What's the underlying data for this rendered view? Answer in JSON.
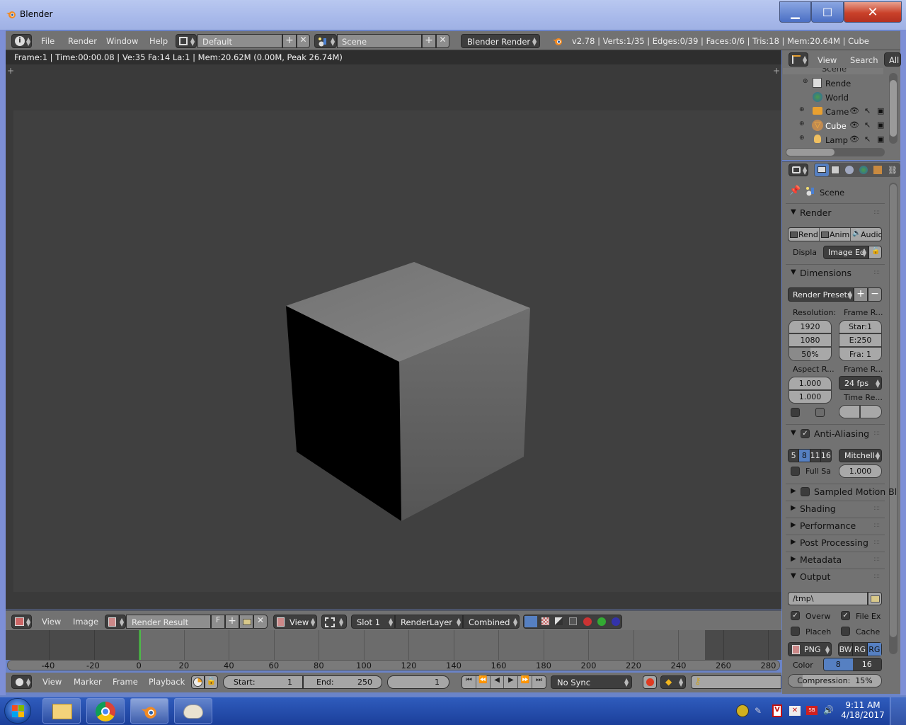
{
  "window": {
    "title": "Blender",
    "controls": {
      "minimize": "▁",
      "maximize": "☐",
      "close": "✕"
    }
  },
  "top_header": {
    "menus": [
      "File",
      "Render",
      "Window",
      "Help"
    ],
    "screen_layout": "Default",
    "scene": "Scene",
    "engine": "Blender Render",
    "stats": "v2.78 | Verts:1/35 | Edges:0/39 | Faces:0/6 | Tris:18 | Mem:20.64M | Cube"
  },
  "render_info": "Frame:1 | Time:00:00.08 | Ve:35 Fa:14 La:1 | Mem:20.62M (0.00M, Peak 26.74M)",
  "image_editor_header": {
    "menus": [
      "View",
      "Image"
    ],
    "image_name": "Render Result",
    "fake_user": "F",
    "view_mode": "View",
    "slot": "Slot 1",
    "render_layer": "RenderLayer",
    "pass": "Combined"
  },
  "timeline": {
    "ticks": [
      "-40",
      "-20",
      "0",
      "20",
      "40",
      "60",
      "80",
      "100",
      "120",
      "140",
      "160",
      "180",
      "200",
      "220",
      "240",
      "260",
      "280"
    ],
    "current_frame_marker": 1,
    "menus": [
      "View",
      "Marker",
      "Frame",
      "Playback"
    ],
    "start_label": "Start:",
    "start_value": "1",
    "end_label": "End:",
    "end_value": "250",
    "current_frame": "1",
    "sync": "No Sync",
    "controls": [
      "⏮",
      "⏪",
      "◀",
      "▶",
      "⏩",
      "⏭"
    ]
  },
  "outliner": {
    "header": {
      "view": "View",
      "search": "Search",
      "filter": "All"
    },
    "items": [
      {
        "label": "Scene",
        "icon": "scene-icon",
        "selected": false
      },
      {
        "label": "Rende",
        "icon": "render-layers-icon",
        "selected": false
      },
      {
        "label": "World",
        "icon": "world-icon",
        "selected": false
      },
      {
        "label": "Came",
        "icon": "camera-icon",
        "selected": false
      },
      {
        "label": "Cube",
        "icon": "mesh-icon",
        "selected": true
      },
      {
        "label": "Lamp",
        "icon": "lamp-icon",
        "selected": false
      }
    ]
  },
  "properties": {
    "context": "Scene",
    "render": {
      "title": "Render",
      "buttons": [
        "Rend",
        "Anim",
        "Audio"
      ],
      "display_label": "Displa",
      "display_value": "Image Ed"
    },
    "dimensions": {
      "title": "Dimensions",
      "presets": "Render Presets",
      "resolution_label": "Resolution:",
      "res_x": "1920",
      "res_y": "1080",
      "res_percent": "50%",
      "res_percent_value": 50,
      "frame_range_label": "Frame R...",
      "frame_start": "Star:1",
      "frame_end": "E:250",
      "frame_step": "Fra: 1",
      "aspect_label": "Aspect R...",
      "aspect_x": "1.000",
      "aspect_y": "1.000",
      "frame_rate_label": "Frame R...",
      "frame_rate": "24 fps",
      "time_remap_label": "Time Re..."
    },
    "anti_aliasing": {
      "title": "Anti-Aliasing",
      "enabled": true,
      "samples": [
        "5",
        "8",
        "11",
        "16"
      ],
      "selected_sample": "8",
      "filter": "Mitchell-",
      "full_sample_label": "Full Sa",
      "filter_size": "1.000"
    },
    "collapsed_panels": [
      "Sampled Motion Bl",
      "Shading",
      "Performance",
      "Post Processing",
      "Metadata"
    ],
    "output": {
      "title": "Output",
      "path": "/tmp\\",
      "overwrite_label": "Overw",
      "overwrite": true,
      "file_ext_label": "File Ex",
      "file_ext": true,
      "placeholders_label": "Placeh",
      "placeholders": false,
      "cache_label": "Cache",
      "cache": false,
      "format": "PNG",
      "color_modes": [
        "BW",
        "RG",
        "RG"
      ],
      "selected_color_mode": 2,
      "color_depth_label": "Color",
      "depths": [
        "8",
        "16"
      ],
      "selected_depth": "8",
      "compression": "Compression:  15%",
      "compression_value": 15
    }
  },
  "taskbar": {
    "apps": [
      "windows-start",
      "file-explorer",
      "chrome",
      "blender",
      "paint"
    ],
    "time": "9:11 AM",
    "date": "4/18/2017"
  },
  "colors": {
    "selected_blue": "#5680c2",
    "frame_cursor_green": "#4fb64a",
    "panel_grey": "#727272"
  }
}
